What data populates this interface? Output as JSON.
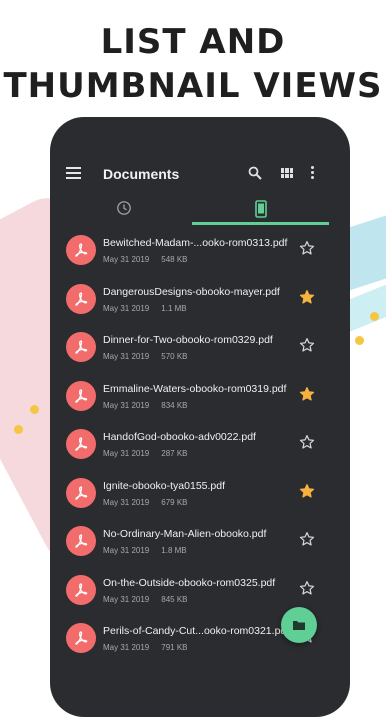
{
  "headline": {
    "line1": "LIST AND",
    "line2": "THUMBNAIL VIEWS"
  },
  "appbar": {
    "title": "Documents",
    "icons": [
      "menu-icon",
      "search-icon",
      "grid-view-icon",
      "more-vert-icon"
    ]
  },
  "tabs": [
    {
      "name": "recent",
      "icon": "clock-icon",
      "active": false
    },
    {
      "name": "device",
      "icon": "phone-icon",
      "active": true
    }
  ],
  "colors": {
    "accent": "#5fcf96",
    "pdf_badge": "#f26c6c",
    "star_filled": "#f6b23c",
    "surface": "#2b2c30"
  },
  "files": [
    {
      "name": "Bewitched-Madam-...ooko-rom0313.pdf",
      "date": "May 31 2019",
      "size": "548 KB",
      "starred": false
    },
    {
      "name": "DangerousDesigns-obooko-mayer.pdf",
      "date": "May 31 2019",
      "size": "1.1 MB",
      "starred": true
    },
    {
      "name": "Dinner-for-Two-obooko-rom0329.pdf",
      "date": "May 31 2019",
      "size": "570 KB",
      "starred": false
    },
    {
      "name": "Emmaline-Waters-obooko-rom0319.pdf",
      "date": "May 31 2019",
      "size": "834 KB",
      "starred": true
    },
    {
      "name": "HandofGod-obooko-adv0022.pdf",
      "date": "May 31 2019",
      "size": "287 KB",
      "starred": false
    },
    {
      "name": "Ignite-obooko-tya0155.pdf",
      "date": "May 31 2019",
      "size": "679 KB",
      "starred": true
    },
    {
      "name": "No-Ordinary-Man-Alien-obooko.pdf",
      "date": "May 31 2019",
      "size": "1.8 MB",
      "starred": false
    },
    {
      "name": "On-the-Outside-obooko-rom0325.pdf",
      "date": "May 31 2019",
      "size": "845 KB",
      "starred": false
    },
    {
      "name": "Perils-of-Candy-Cut...ooko-rom0321.pdf",
      "date": "May 31 2019",
      "size": "791 KB",
      "starred": false
    }
  ],
  "fab": {
    "icon": "folder-icon"
  }
}
